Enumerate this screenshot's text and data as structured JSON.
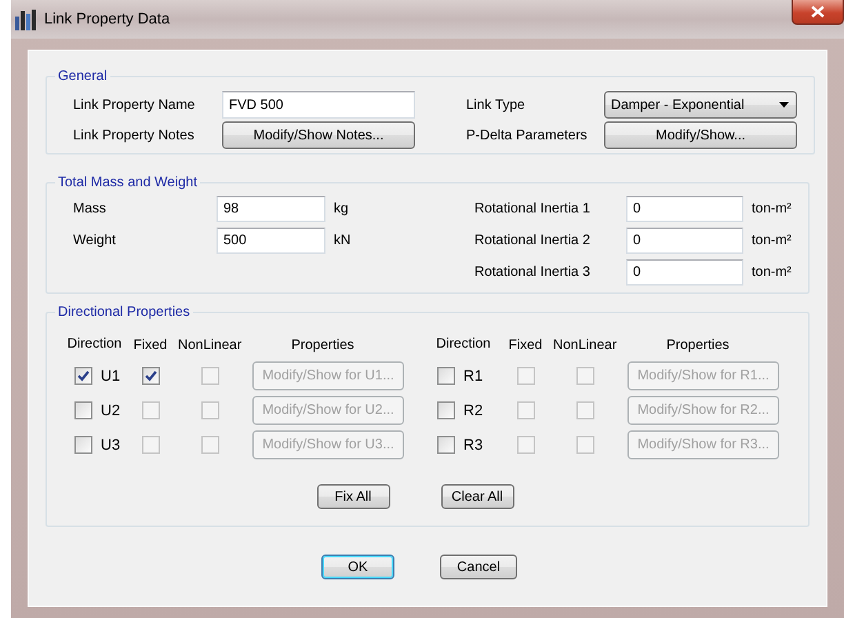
{
  "window": {
    "title": "Link Property Data"
  },
  "general": {
    "legend": "General",
    "name_label": "Link Property Name",
    "name_value": "FVD 500",
    "notes_label": "Link Property Notes",
    "notes_button": "Modify/Show Notes...",
    "type_label": "Link Type",
    "type_value": "Damper - Exponential",
    "pdelta_label": "P-Delta Parameters",
    "pdelta_button": "Modify/Show..."
  },
  "mass": {
    "legend": "Total Mass and Weight",
    "fields": [
      {
        "label": "Mass",
        "value": "98",
        "unit": "kg"
      },
      {
        "label": "Weight",
        "value": "500",
        "unit": "kN"
      }
    ],
    "inertia": [
      {
        "label": "Rotational Inertia 1",
        "value": "0",
        "unit": "ton-m²"
      },
      {
        "label": "Rotational Inertia 2",
        "value": "0",
        "unit": "ton-m²"
      },
      {
        "label": "Rotational Inertia 3",
        "value": "0",
        "unit": "ton-m²"
      }
    ]
  },
  "directional": {
    "legend": "Directional Properties",
    "groups": [
      {
        "headers": [
          "Direction",
          "Fixed",
          "NonLinear",
          "Properties"
        ],
        "rows": [
          {
            "name": "U1",
            "checked": true,
            "fixed": {
              "checked": true,
              "disabled": false
            },
            "nonlinear": {
              "checked": false,
              "disabled": true
            },
            "button": {
              "label": "Modify/Show for U1...",
              "disabled": true
            }
          },
          {
            "name": "U2",
            "checked": false,
            "fixed": {
              "checked": false,
              "disabled": true
            },
            "nonlinear": {
              "checked": false,
              "disabled": true
            },
            "button": {
              "label": "Modify/Show for U2...",
              "disabled": true
            }
          },
          {
            "name": "U3",
            "checked": false,
            "fixed": {
              "checked": false,
              "disabled": true
            },
            "nonlinear": {
              "checked": false,
              "disabled": true
            },
            "button": {
              "label": "Modify/Show for U3...",
              "disabled": true
            }
          }
        ]
      },
      {
        "headers": [
          "Direction",
          "Fixed",
          "NonLinear",
          "Properties"
        ],
        "rows": [
          {
            "name": "R1",
            "checked": false,
            "fixed": {
              "checked": false,
              "disabled": true
            },
            "nonlinear": {
              "checked": false,
              "disabled": true
            },
            "button": {
              "label": "Modify/Show for R1...",
              "disabled": true
            }
          },
          {
            "name": "R2",
            "checked": false,
            "fixed": {
              "checked": false,
              "disabled": true
            },
            "nonlinear": {
              "checked": false,
              "disabled": true
            },
            "button": {
              "label": "Modify/Show for R2...",
              "disabled": true
            }
          },
          {
            "name": "R3",
            "checked": false,
            "fixed": {
              "checked": false,
              "disabled": true
            },
            "nonlinear": {
              "checked": false,
              "disabled": true
            },
            "button": {
              "label": "Modify/Show for R3...",
              "disabled": true
            }
          }
        ]
      }
    ],
    "actions": [
      "Fix All",
      "Clear All"
    ]
  },
  "buttons": [
    {
      "label": "OK",
      "default": true
    },
    {
      "label": "Cancel",
      "default": false
    }
  ]
}
